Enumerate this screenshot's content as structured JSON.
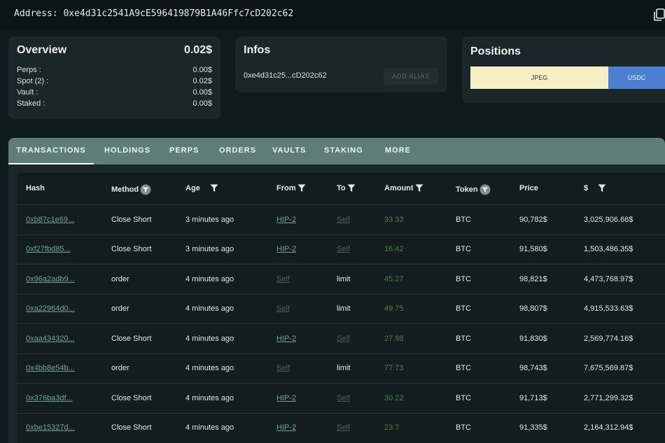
{
  "address_bar": {
    "label": "Address:",
    "value": "0xe4d31c2541A9cE596419879B1A46Ffc7cD202c62"
  },
  "overview": {
    "title": "Overview",
    "total": "0.02$",
    "rows": [
      {
        "label": "Perps :",
        "value": "0.00$"
      },
      {
        "label": "Spot (2) :",
        "value": "0.02$"
      },
      {
        "label": "Vault :",
        "value": "0.00$"
      },
      {
        "label": "Staked :",
        "value": "0.00$"
      }
    ]
  },
  "infos": {
    "title": "Infos",
    "address_short": "0xe4d31c25...cD202c62",
    "alias_button": "ADD ALIAS"
  },
  "positions": {
    "title": "Positions",
    "segments": [
      {
        "label": "JPEG",
        "share": 0.71,
        "color": "#f5efc3"
      },
      {
        "label": "USDC",
        "share": 0.29,
        "color": "#4a7fd1"
      }
    ]
  },
  "tabs": [
    "TRANSACTIONS",
    "HOLDINGS",
    "PERPS",
    "ORDERS",
    "VAULTS",
    "STAKING",
    "MORE"
  ],
  "table": {
    "headers": [
      "Hash",
      "Method",
      "Age",
      "From",
      "To",
      "Amount",
      "Token",
      "Price",
      "$"
    ],
    "rows": [
      {
        "hash": "0xb87c1e69...",
        "method": "Close Short",
        "age": "3 minutes ago",
        "from": "HIP-2",
        "to": "Self",
        "amount": "33.33",
        "token": "BTC",
        "price": "90,782$",
        "usd": "3,025,906.66$"
      },
      {
        "hash": "0xf27fbd85...",
        "method": "Close Short",
        "age": "3 minutes ago",
        "from": "HIP-2",
        "to": "Self",
        "amount": "16.42",
        "token": "BTC",
        "price": "91,580$",
        "usd": "1,503,486.35$"
      },
      {
        "hash": "0x96a2adb9...",
        "method": "order",
        "age": "4 minutes ago",
        "from": "Self",
        "to": "limit",
        "amount": "45.27",
        "token": "BTC",
        "price": "98,821$",
        "usd": "4,473,768.97$"
      },
      {
        "hash": "0xa22964d0...",
        "method": "order",
        "age": "4 minutes ago",
        "from": "Self",
        "to": "limit",
        "amount": "49.75",
        "token": "BTC",
        "price": "98,807$",
        "usd": "4,915,533.63$"
      },
      {
        "hash": "0xaa434320...",
        "method": "Close Short",
        "age": "4 minutes ago",
        "from": "HIP-2",
        "to": "Self",
        "amount": "27.98",
        "token": "BTC",
        "price": "91,830$",
        "usd": "2,569,774.16$"
      },
      {
        "hash": "0x4bb8e54b...",
        "method": "order",
        "age": "4 minutes ago",
        "from": "Self",
        "to": "limit",
        "amount": "77.73",
        "token": "BTC",
        "price": "98,743$",
        "usd": "7,675,569.87$"
      },
      {
        "hash": "0x376ba3df...",
        "method": "Close Short",
        "age": "4 minutes ago",
        "from": "HIP-2",
        "to": "Self",
        "amount": "30.22",
        "token": "BTC",
        "price": "91,713$",
        "usd": "2,771,299.32$"
      },
      {
        "hash": "0xbe15327d...",
        "method": "Close Short",
        "age": "4 minutes ago",
        "from": "HIP-2",
        "to": "Self",
        "amount": "23.7",
        "token": "BTC",
        "price": "91,335$",
        "usd": "2,164,312.94$"
      }
    ]
  }
}
